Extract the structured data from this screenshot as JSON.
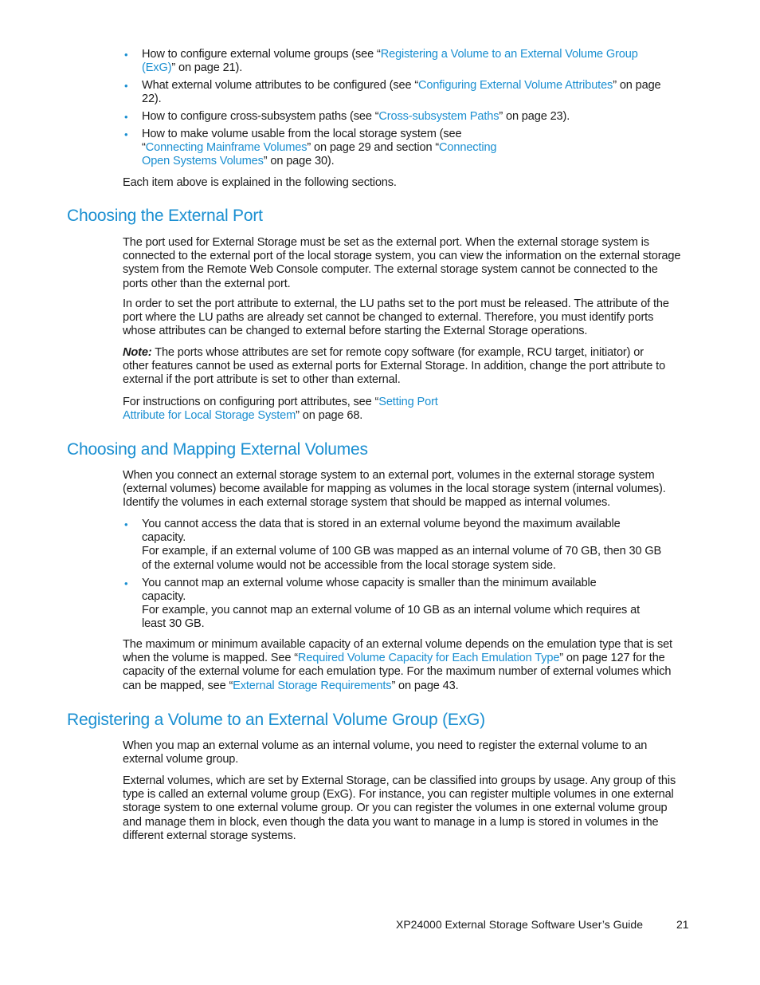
{
  "intro_bullets": [
    {
      "pre": "How to configure external volume groups (see “",
      "link": "Registering a Volume to an External Volume Group (ExG)",
      "post": "” on page 21)."
    },
    {
      "pre": "What external volume attributes to be configured (see “",
      "link": "Configuring External Volume Attributes",
      "post": "” on page 22)."
    },
    {
      "pre": "How to configure cross-subsystem paths (see “",
      "link": "Cross-subsystem Paths",
      "post": "” on page 23)."
    },
    {
      "pre": "How to make volume usable from the local storage system (see “",
      "link": "Connecting Mainframe Volumes",
      "mid": "” on page 29 and section “",
      "link2": "Connecting Open Systems Volumes",
      "post": "” on page 30)."
    }
  ],
  "intro_summary": "Each item above is explained in the following sections.",
  "section1": {
    "title": "Choosing the External Port",
    "p1": "The port used for External Storage must be set as the external port. When the external storage system is connected to the external port of the local storage system, you can view the information on the external storage system from the Remote Web Console computer. The external storage system cannot be connected to the ports other than the external port.",
    "p2": "In order to set the port attribute to external, the LU paths set to the port must be released. The attribute of the port where the LU paths are already set cannot be changed to external. Therefore, you must identify ports whose attributes can be changed to external before starting the External Storage operations.",
    "note_label": "Note:",
    "note_text": " The ports whose attributes are set for remote copy software (for example, RCU target, initiator) or other features cannot be used as external ports for External Storage. In addition, change the port attribute to external if the port attribute is set to other than external.",
    "p3_pre": "For instructions on configuring port attributes, see “",
    "p3_link": "Setting Port Attribute for Local Storage System",
    "p3_post": "” on page 68."
  },
  "section2": {
    "title": "Choosing and Mapping External Volumes",
    "p1": "When you connect an external storage system to an external port, volumes in the external storage system (external volumes) become available for mapping as volumes in the local storage system (internal volumes). Identify the volumes in each external storage system that should be mapped as internal volumes.",
    "bullets": [
      {
        "line1": "You cannot access the data that is stored in an external volume beyond the maximum available capacity.",
        "line2": "For example, if an external volume of 100 GB was mapped as an internal volume of 70 GB, then 30 GB of the external volume would not be accessible from the local storage system side."
      },
      {
        "line1": "You cannot map an external volume whose capacity is smaller than the minimum available capacity.",
        "line2": "For example, you cannot map an external volume of 10 GB as an internal volume which requires at least 30 GB."
      }
    ],
    "p2_pre": "The maximum or minimum available capacity of an external volume depends on the emulation type that is set when the volume is mapped. See “",
    "p2_link1": "Required Volume Capacity for Each Emulation Type",
    "p2_mid": "” on page 127 for the capacity of the external volume for each emulation type. For the maximum number of external volumes which can be mapped, see “",
    "p2_link2": "External Storage Requirements",
    "p2_post": "” on page 43."
  },
  "section3": {
    "title": "Registering a Volume to an External Volume Group (ExG)",
    "p1": "When you map an external volume as an internal volume, you need to register the external volume to an external volume group.",
    "p2": "External volumes, which are set by External Storage, can be classified into groups by usage. Any group of this type is called an external volume group (ExG). For instance, you can register multiple volumes in one external storage system to one external volume group. Or you can register the volumes in one external volume group and manage them in block, even though the data you want to manage in a lump is stored in volumes in the different external storage systems."
  },
  "footer": {
    "title": "XP24000 External Storage Software User’s Guide",
    "page_number": "21"
  },
  "colors": {
    "accent": "#1a8fd1",
    "text": "#1a1a1a"
  }
}
